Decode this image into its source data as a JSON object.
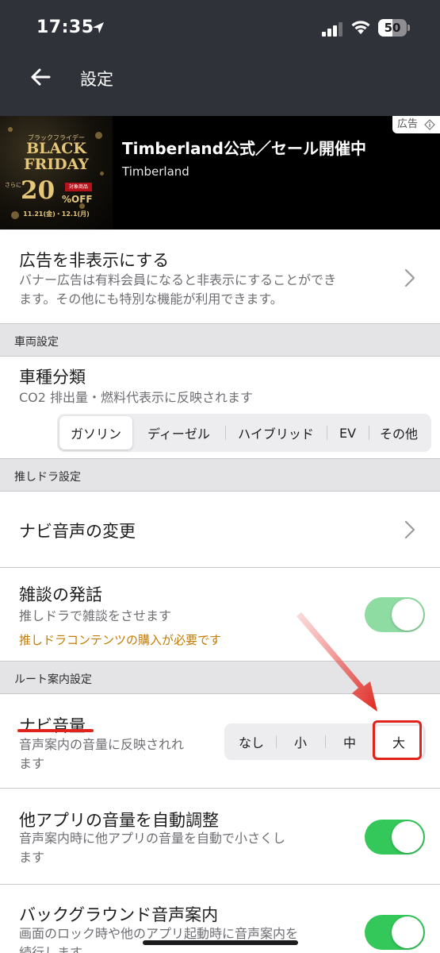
{
  "status_bar": {
    "time": "17:35",
    "battery": "50"
  },
  "nav": {
    "title": "設定"
  },
  "ad": {
    "badge": "広告",
    "image_sub": "ブラックフライデー",
    "image_line1": "BLACK",
    "image_line2": "FRIDAY",
    "image_extra": "さらに",
    "image_percent": "20",
    "image_off": "%OFF",
    "image_tag": "対象商品",
    "image_dates": "11.21(金)・12.1(月)",
    "title": "Timberland公式／セール開催中",
    "advertiser": "Timberland"
  },
  "hide_ads": {
    "title": "広告を非表示にする",
    "desc_line1": "バナー広告は有料会員になると非表示にすることができ",
    "desc_line2": "ます。その他にも特別な機能が利用できます。"
  },
  "sections": {
    "vehicle": "車両設定",
    "oshidora": "推しドラ設定",
    "route": "ルート案内設定"
  },
  "vehicle_type": {
    "title": "車種分類",
    "desc": "CO2 排出量・燃料代表示に反映されます",
    "options": [
      "ガソリン",
      "ディーゼル",
      "ハイブリッド",
      "EV",
      "その他"
    ],
    "selected": "ガソリン"
  },
  "navi_voice_change": {
    "title": "ナビ音声の変更"
  },
  "chat": {
    "title": "雑談の発話",
    "desc": "推しドラで雑談をさせます",
    "warning": "推しドラコンテンツの購入が必要です",
    "enabled": true,
    "color": "#8fdca3"
  },
  "navi_volume": {
    "title": "ナビ音量",
    "desc_line1": "音声案内の音量に反映されれ",
    "desc_line2": "ます",
    "options": [
      "なし",
      "小",
      "中",
      "大"
    ],
    "selected": "大"
  },
  "auto_adjust": {
    "title": "他アプリの音量を自動調整",
    "desc_line1": "音声案内時に他アプリの音量を自動で小さくし",
    "desc_line2": "ます",
    "enabled": true,
    "color": "#34c759"
  },
  "background_voice": {
    "title": "バックグラウンド音声案内",
    "desc_line1": "画面のロック時や他のアプリ起動時に音声案内を",
    "desc_line2": "続行します",
    "enabled": true,
    "color": "#34c759"
  },
  "colors": {
    "header_bg": "#2f3238",
    "section_bg": "#e4e4e6",
    "toggle_on": "#34c759",
    "warning": "#c47a00",
    "annotation": "#e0241b"
  }
}
